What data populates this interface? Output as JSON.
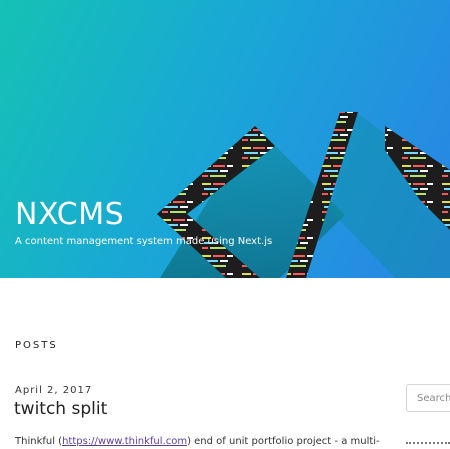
{
  "header": {
    "title": "NXCMS",
    "subtitle": "A content management system made using Next.js"
  },
  "posts_section": {
    "heading": "POSTS"
  },
  "posts": [
    {
      "date": "April 2, 2017",
      "title": "twitch split",
      "excerpt_prefix": "Thinkful (",
      "link_text": "https://www.thinkful.com",
      "excerpt_suffix": ") end of unit portfolio project - a multi-"
    }
  ],
  "sidebar": {
    "search_placeholder": "Search"
  },
  "colors": {
    "hero_start": "#15c2b4",
    "hero_end": "#2a83e6",
    "link": "#5a3e9c"
  }
}
